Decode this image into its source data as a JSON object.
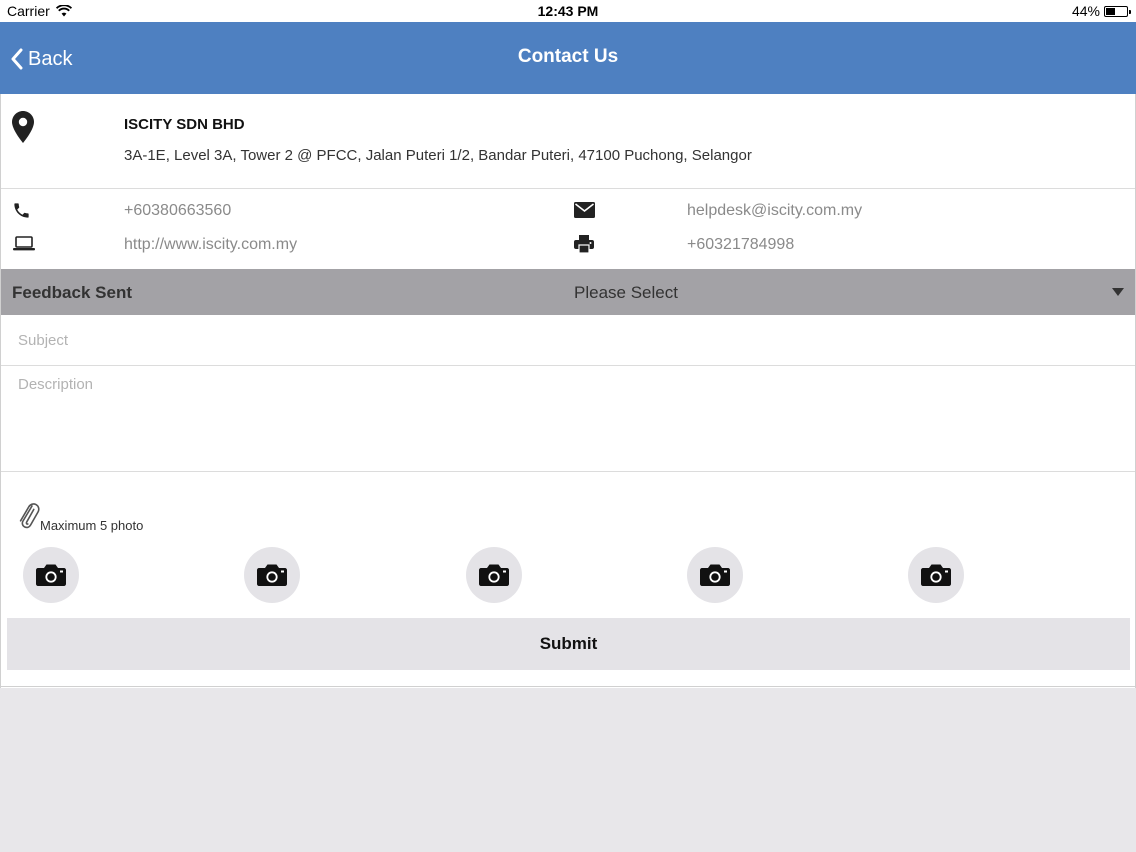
{
  "status_bar": {
    "carrier": "Carrier",
    "time": "12:43 PM",
    "battery": "44%",
    "battery_level": 0.44
  },
  "nav": {
    "back_label": "Back",
    "title": "Contact Us",
    "color": "#4e80c1"
  },
  "company": {
    "name": "ISCITY SDN BHD",
    "address": "3A-1E, Level 3A, Tower 2 @ PFCC, Jalan Puteri 1/2, Bandar Puteri, 47100 Puchong, Selangor"
  },
  "contacts": {
    "phone": "+60380663560",
    "email": "helpdesk@iscity.com.my",
    "website": "http://www.iscity.com.my",
    "fax": "+60321784998"
  },
  "feedback": {
    "label": "Feedback Sent",
    "select_value": "Please Select"
  },
  "form": {
    "subject_placeholder": "Subject",
    "description_placeholder": "Description",
    "attach_note": "Maximum 5 photo",
    "submit_label": "Submit"
  },
  "icons": {
    "location": "map-pin-icon",
    "phone": "phone-icon",
    "email": "envelope-icon",
    "website": "laptop-icon",
    "fax": "printer-icon",
    "attachment": "paperclip-icon",
    "photo": "camera-icon",
    "dropdown": "caret-down-icon"
  }
}
